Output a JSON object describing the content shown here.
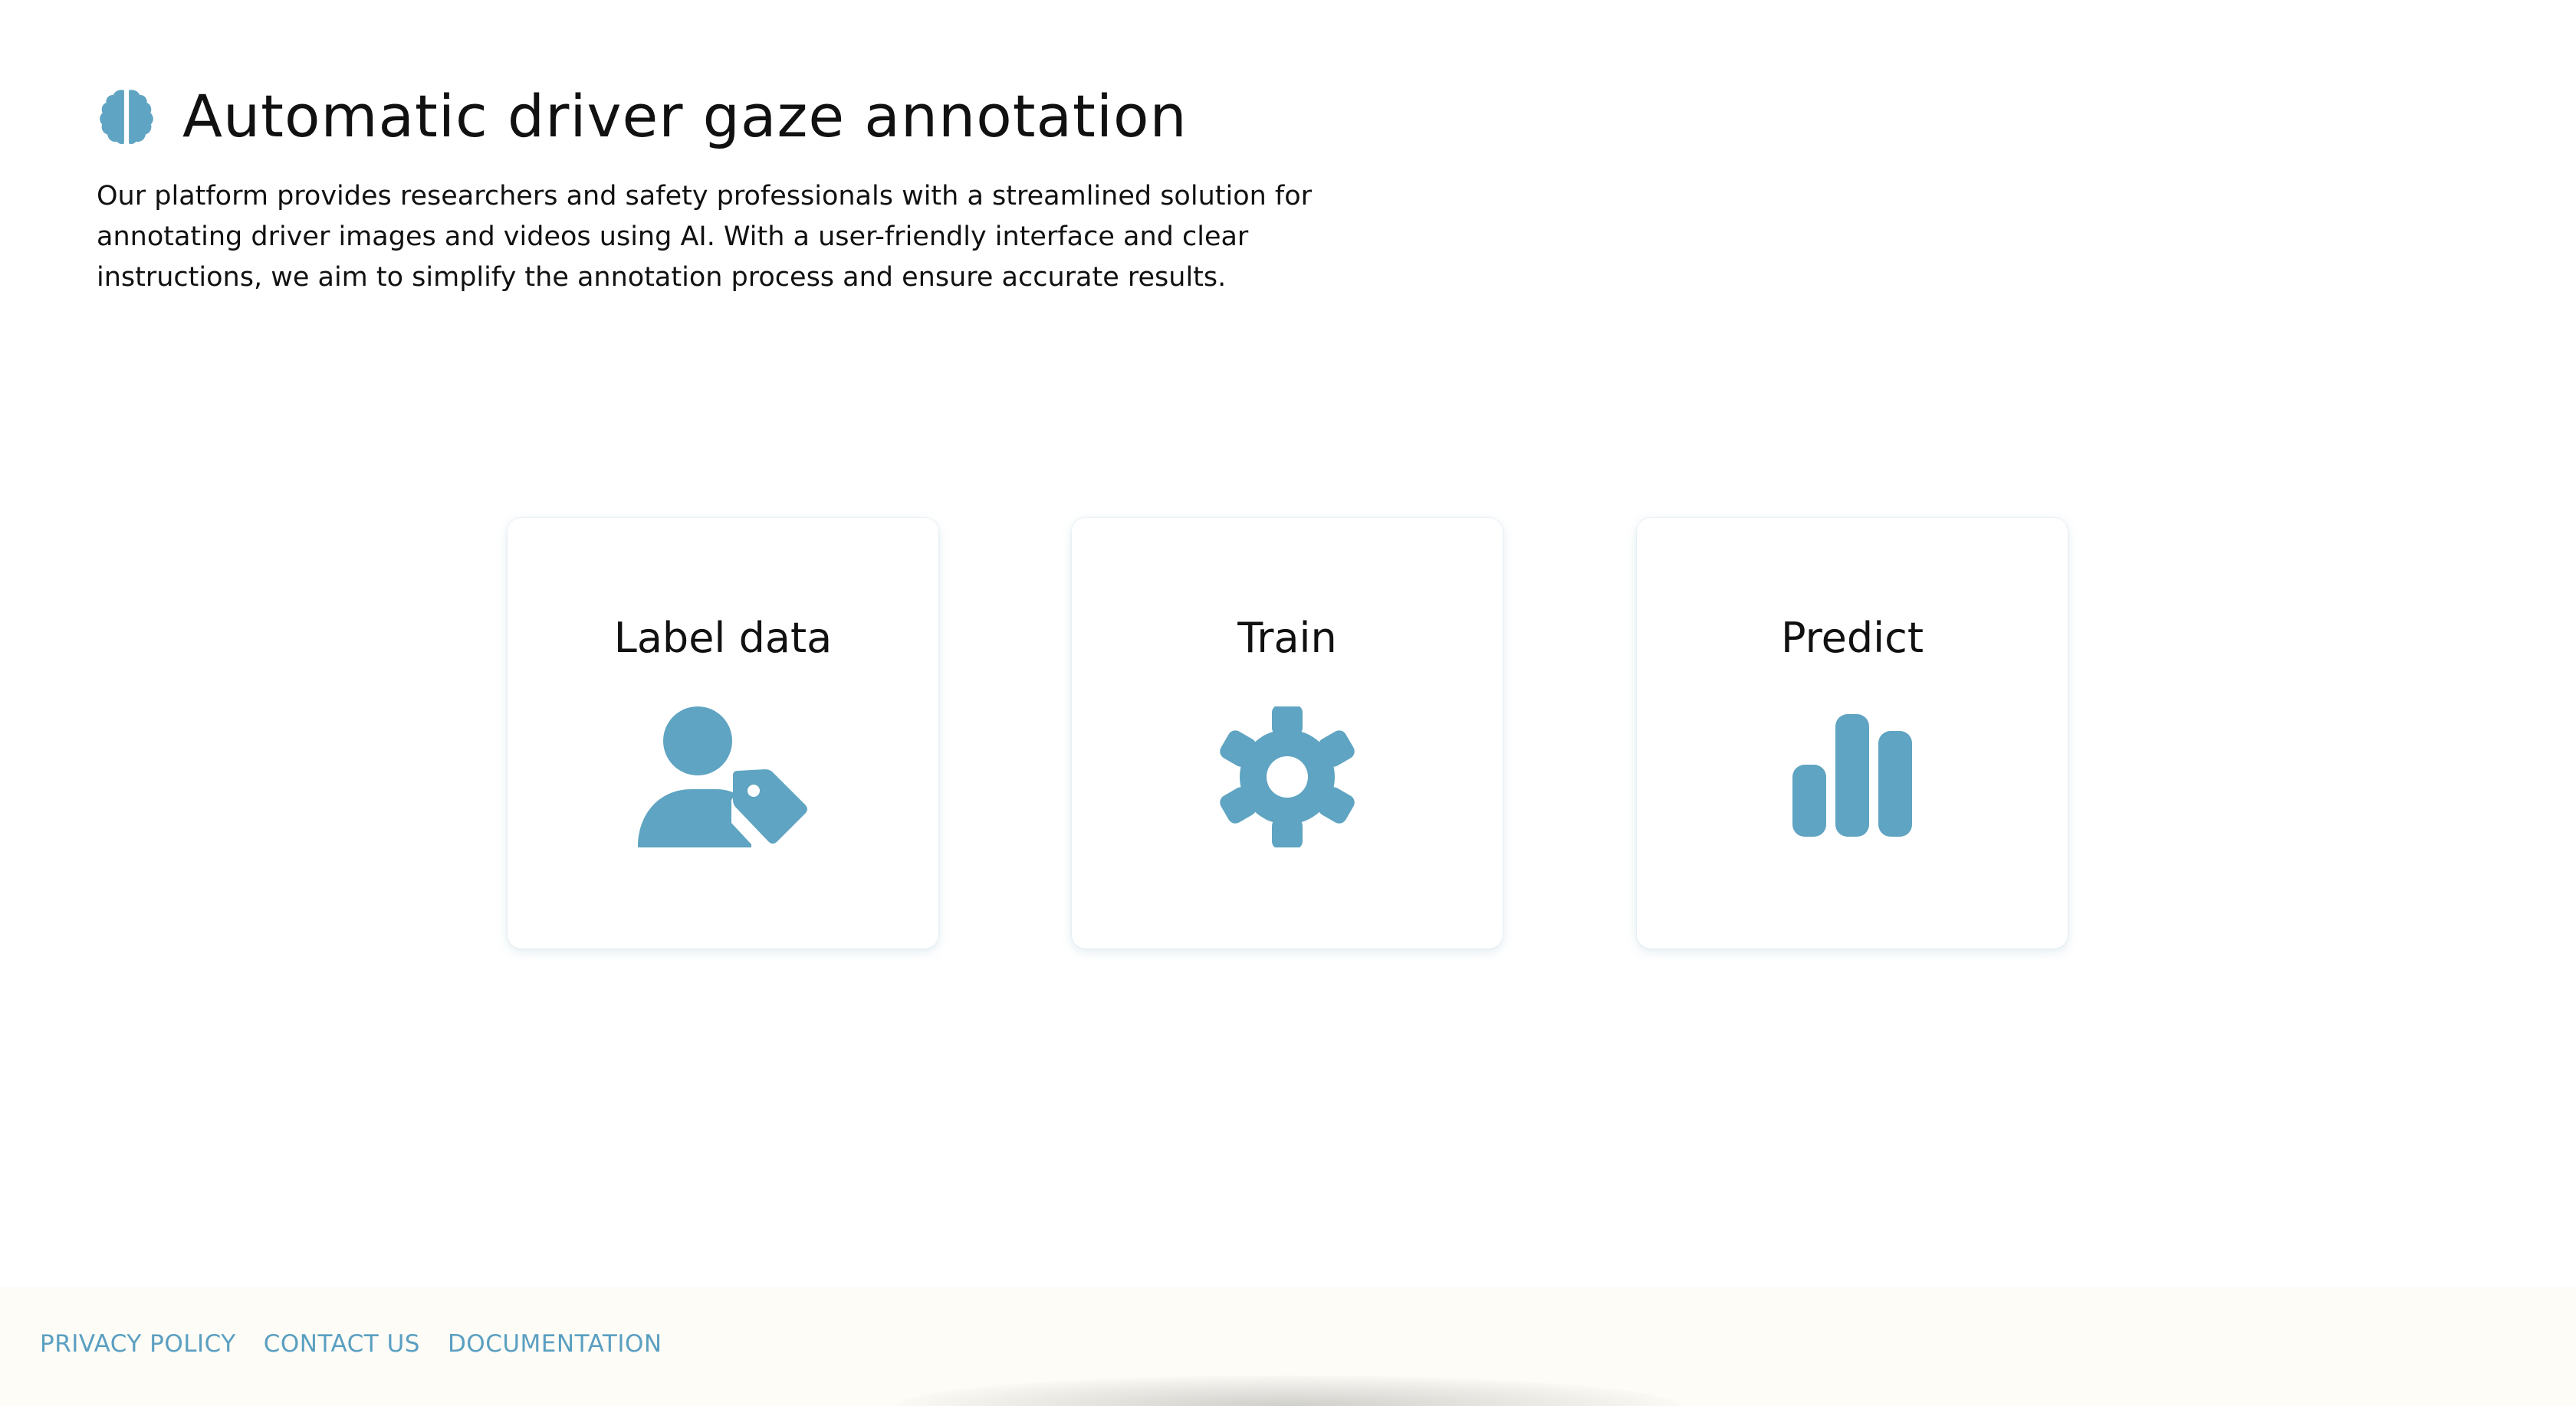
{
  "header": {
    "title": "Automatic driver gaze annotation",
    "description": "Our platform provides researchers and safety professionals with a streamlined solution for annotating driver images and videos using AI. With a user-friendly interface and clear instructions, we aim to simplify the annotation process and ensure accurate results.",
    "logo_icon": "brain-icon"
  },
  "cards": [
    {
      "label": "Label data",
      "icon": "user-tag-icon"
    },
    {
      "label": "Train",
      "icon": "gear-icon"
    },
    {
      "label": "Predict",
      "icon": "bar-chart-icon"
    }
  ],
  "footer": {
    "links": [
      "PRIVACY POLICY",
      "CONTACT US",
      "DOCUMENTATION"
    ]
  },
  "colors": {
    "accent": "#5fa4c2",
    "link": "#5a9fc1",
    "text": "#111111",
    "footer_bg": "#fdfcf7"
  }
}
